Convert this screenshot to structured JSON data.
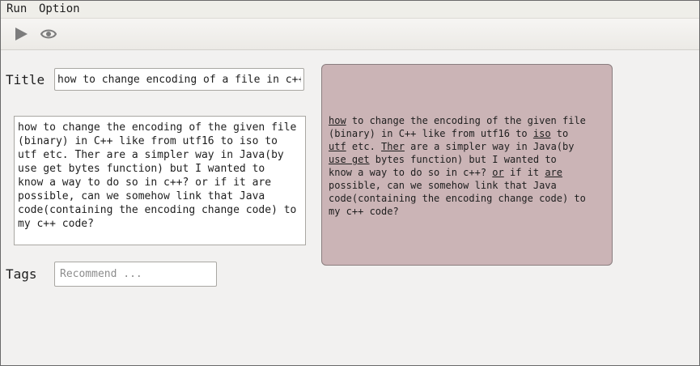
{
  "menubar": {
    "run": "Run",
    "option": "Option"
  },
  "toolbar": {
    "run_icon": "play-icon",
    "preview_icon": "eye-icon"
  },
  "form": {
    "title_label": "Title",
    "title_value": "how to change encoding of a file in c++",
    "body_value": "how to change the encoding of the given file\n(binary) in C++ like from utf16 to iso to\nutf etc. Ther are a simpler way in Java(by\nuse get bytes function) but I wanted to\nknow a way to do so in c++? or if it are\npossible, can we somehow link that Java\ncode(containing the encoding change code) to\nmy c++ code?",
    "tags_label": "Tags",
    "tags_placeholder": "Recommend ..."
  },
  "preview": {
    "lines": [
      [
        {
          "t": "how",
          "u": true
        },
        {
          "t": " to change the encoding of the given file"
        }
      ],
      [
        {
          "t": "(binary) in C++ like from utf16 to "
        },
        {
          "t": "iso",
          "u": true
        },
        {
          "t": " to"
        }
      ],
      [
        {
          "t": "utf",
          "u": true
        },
        {
          "t": " etc. "
        },
        {
          "t": "Ther",
          "u": true
        },
        {
          "t": " are a simpler way in Java(by"
        }
      ],
      [
        {
          "t": "use get",
          "u": true
        },
        {
          "t": " bytes function) but I wanted to"
        }
      ],
      [
        {
          "t": "know a way to do so in c++? "
        },
        {
          "t": "or",
          "u": true
        },
        {
          "t": " if it "
        },
        {
          "t": "are",
          "u": true
        }
      ],
      [
        {
          "t": "possible, can we somehow link that Java"
        }
      ],
      [
        {
          "t": "code(containing the encoding change code) to"
        }
      ],
      [
        {
          "t": "my c++ code?"
        }
      ]
    ]
  },
  "colors": {
    "preview_bg": "#cbb4b6",
    "window_bg": "#f2f1f0"
  }
}
